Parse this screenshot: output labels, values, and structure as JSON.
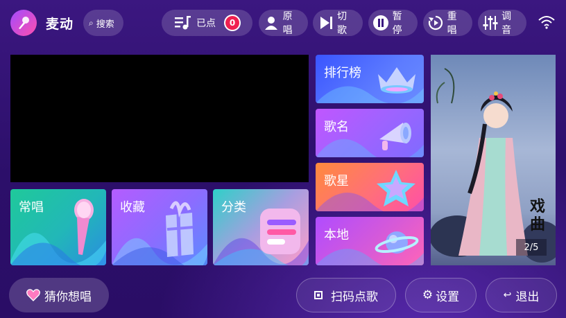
{
  "app": {
    "title": "麦动"
  },
  "top_bar": {
    "search_label": "搜索",
    "queued_label": "已点",
    "queued_count": "0",
    "controls": [
      {
        "label": "原唱",
        "icon": "vocal-person-icon"
      },
      {
        "label": "切歌",
        "icon": "skip-next-icon"
      },
      {
        "label": "暂停",
        "icon": "pause-icon"
      },
      {
        "label": "重唱",
        "icon": "replay-icon"
      },
      {
        "label": "调音",
        "icon": "equalizer-icon"
      }
    ]
  },
  "tiles": {
    "ranking": "排行榜",
    "song_name": "歌名",
    "singer": "歌星",
    "local": "本地",
    "frequent": "常唱",
    "favorites": "收藏",
    "category": "分类"
  },
  "poster": {
    "calligraphy": "戏曲",
    "page_indicator": "2/5"
  },
  "bottom": {
    "guess_label": "猜你想唱",
    "scan_label": "扫码点歌",
    "settings_label": "设置",
    "exit_label": "退出"
  },
  "colors": {
    "accent_red": "#f02050",
    "background": "#2c0f6a"
  }
}
